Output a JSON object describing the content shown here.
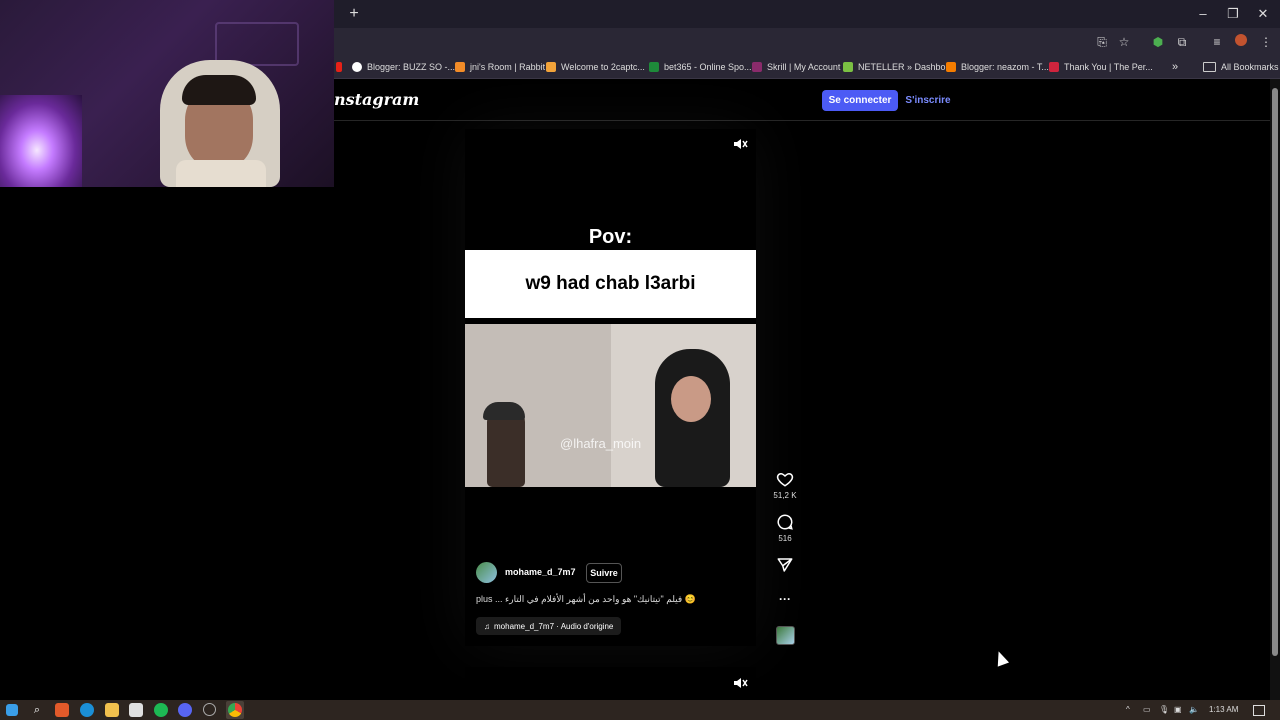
{
  "browser": {
    "new_tab": "+",
    "window_controls": [
      "–",
      "❐",
      "✕"
    ],
    "bookmarks": [
      {
        "label": "Blogger: BUZZ SO -...",
        "color": "#ffffff"
      },
      {
        "label": "jni's Room | Rabbit",
        "color": "#f28c28"
      },
      {
        "label": "Welcome to 2captc...",
        "color": "#f2a33a"
      },
      {
        "label": "bet365 - Online Spo...",
        "color": "#1e8a3a"
      },
      {
        "label": "Skrill | My Account",
        "color": "#8a2b6b"
      },
      {
        "label": "NETELLER » Dashbo...",
        "color": "#7bc043"
      },
      {
        "label": "Blogger: neazom - T...",
        "color": "#f57d00"
      },
      {
        "label": "Thank You | The Per...",
        "color": "#d0243d"
      }
    ],
    "more_bookmarks": "»",
    "all_bookmarks": "All Bookmarks"
  },
  "instagram": {
    "logo": "nstagram",
    "login_label": "Se connecter",
    "signup_label": "S'inscrire"
  },
  "reel": {
    "pov": "Pov:",
    "caption": "w9 had chab l3arbi",
    "watermark": "@lhafra_moin",
    "username": "mohame_d_7m7",
    "follow_label": "Suivre",
    "description": "plus ... فيلم \"تيتانيك\" هو واحد من أشهر الأفلام في التارء 😊",
    "audio_label": "mohame_d_7m7 · Audio d'origine",
    "likes": "51,2 K",
    "comments": "516",
    "more": "···"
  },
  "taskbar": {
    "time": "1:13 AM"
  }
}
